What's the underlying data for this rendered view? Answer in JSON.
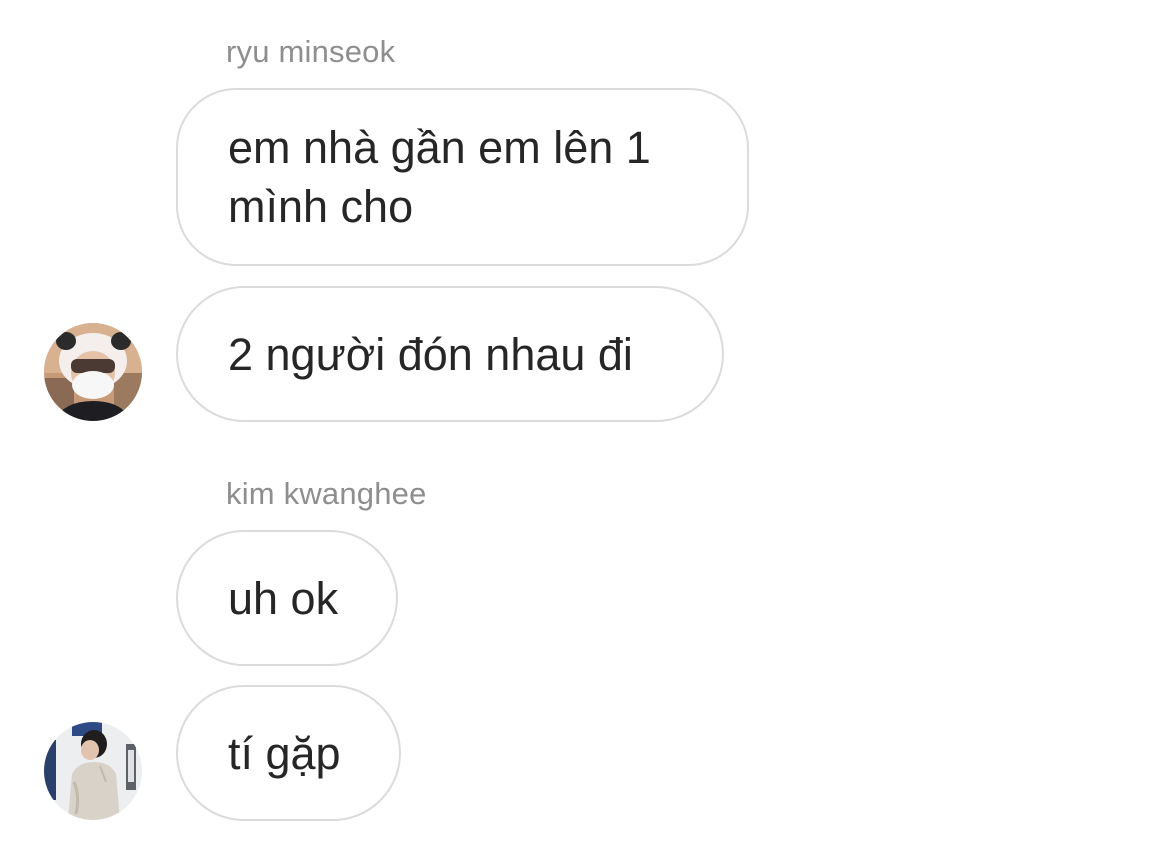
{
  "conversation": {
    "groups": [
      {
        "sender": "ryu minseok",
        "messages": [
          "em nhà gần em lên 1 mình cho",
          "2 người đón nhau đi"
        ],
        "avatar_icon": "panda-hat-masked-person-avatar"
      },
      {
        "sender": "kim kwanghee",
        "messages": [
          "uh ok",
          "tí gặp"
        ],
        "avatar_icon": "hoodie-person-avatar"
      }
    ]
  },
  "colors": {
    "bubble_border": "#dbdbdb",
    "bubble_text": "#262626",
    "sender_name": "#8e8e8e",
    "background": "#ffffff"
  }
}
